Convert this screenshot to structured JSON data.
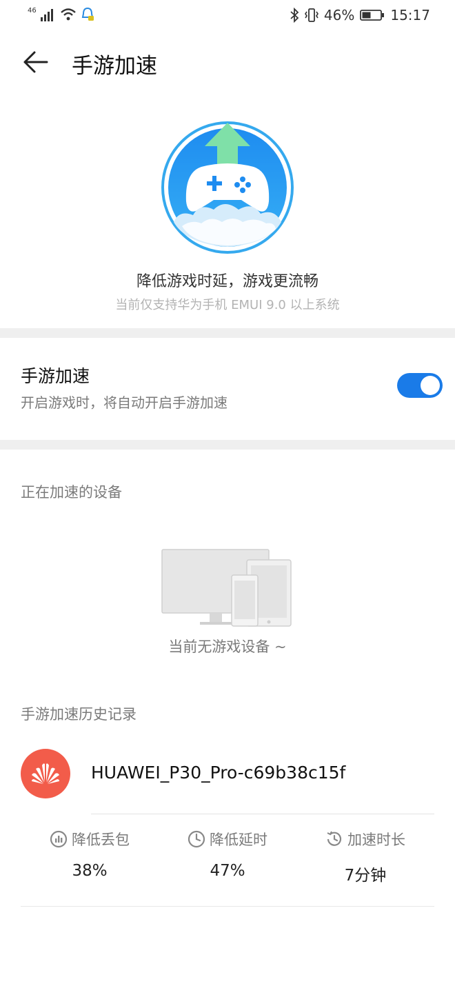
{
  "status_bar": {
    "network": "46",
    "battery": "46%",
    "time": "15:17",
    "icons": [
      "signal-icon",
      "wifi-icon",
      "notification-icon",
      "bluetooth-icon",
      "vibrate-icon",
      "battery-icon"
    ]
  },
  "header": {
    "title": "手游加速",
    "back_icon": "back-arrow-icon"
  },
  "hero": {
    "icon": "gamepad-boost-icon",
    "main_text": "降低游戏时延，游戏更流畅",
    "sub_text": "当前仅支持华为手机 EMUI 9.0 以上系统"
  },
  "accel_toggle": {
    "title": "手游加速",
    "subtitle": "开启游戏时，将自动开启手游加速",
    "enabled": true,
    "accent": "#1a7be8"
  },
  "devices": {
    "section_title": "正在加速的设备",
    "empty_text": "当前无游戏设备 ~",
    "illustration": "devices-illustration"
  },
  "history": {
    "section_title": "手游加速历史记录",
    "records": [
      {
        "device_name": "HUAWEI_P30_Pro-c69b38c15f",
        "logo": "huawei-logo-icon",
        "logo_color": "#f25c4a",
        "stats": [
          {
            "label": "降低丢包",
            "value": "38%",
            "icon": "bar-chart-icon"
          },
          {
            "label": "降低延时",
            "value": "47%",
            "icon": "clock-icon"
          },
          {
            "label": "加速时长",
            "value": "7分钟",
            "icon": "history-icon"
          }
        ]
      }
    ]
  }
}
